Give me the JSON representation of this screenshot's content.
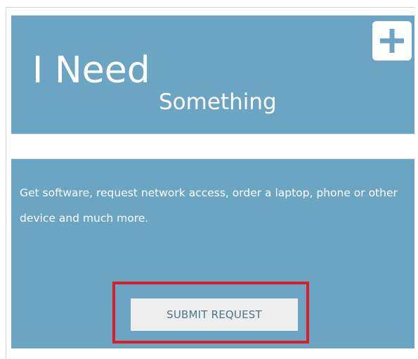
{
  "tile": {
    "title_line1": "I Need",
    "title_line2": "Something",
    "add_icon": "plus-icon",
    "description": "Get software, request network access, order a laptop, phone or other device and much more.",
    "submit_label": "SUBMIT REQUEST"
  },
  "colors": {
    "tile_blue": "#6ca5c4",
    "button_bg": "#eeeeee",
    "button_text": "#4f7487",
    "highlight_red": "#d81f26",
    "icon_color": "#6ca5c4"
  }
}
